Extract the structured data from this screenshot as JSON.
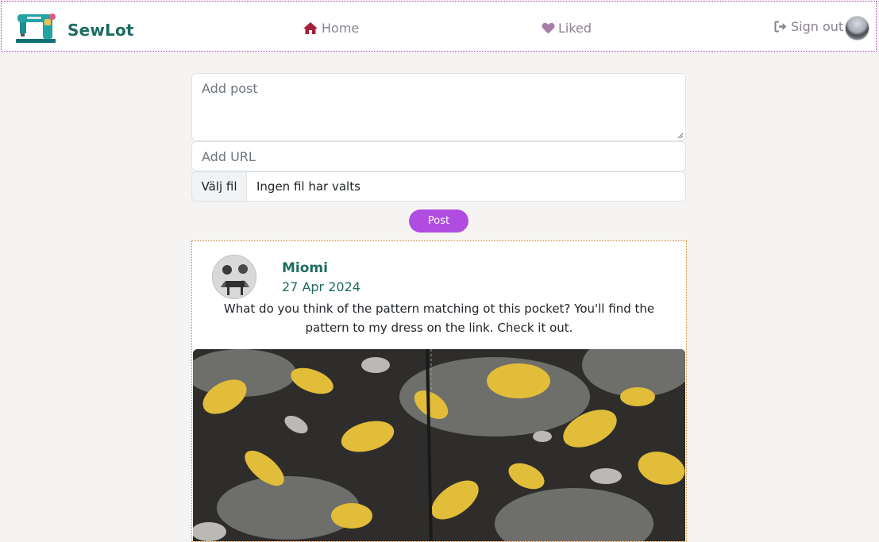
{
  "navbar": {
    "brand": "SewLot",
    "home_label": "Home",
    "liked_label": "Liked",
    "signout_label": "Sign out",
    "colors": {
      "brand": "#1d6b61",
      "home_icon": "#a3203a",
      "liked_icon": "#a77dab",
      "link": "#8b8290"
    },
    "icons": {
      "logo": "sewing-machine-icon",
      "home": "home-icon",
      "liked": "heart-icon",
      "signout": "sign-out-icon"
    }
  },
  "form": {
    "post_placeholder": "Add post",
    "url_placeholder": "Add URL",
    "file_button_label": "Välj fil",
    "file_status": "Ingen fil har valts",
    "submit_label": "Post",
    "submit_color": "#b04de0"
  },
  "post": {
    "author": "Miomi",
    "date": "27 Apr 2024",
    "text": "What do you think of the pattern matching ot this pocket? You'll find the pattern to my dress on the link. Check it out."
  }
}
